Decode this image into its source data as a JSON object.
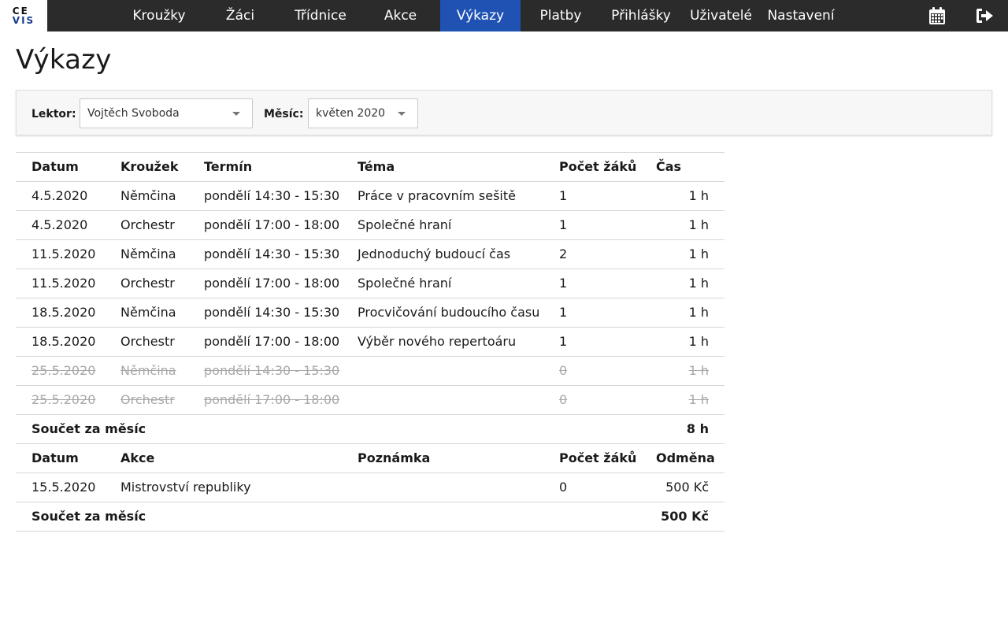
{
  "logo": {
    "line1": "CE",
    "line2": "VIS"
  },
  "nav": {
    "items": [
      {
        "label": "Kroužky",
        "active": false
      },
      {
        "label": "Žáci",
        "active": false
      },
      {
        "label": "Třídnice",
        "active": false
      },
      {
        "label": "Akce",
        "active": false
      },
      {
        "label": "Výkazy",
        "active": true
      },
      {
        "label": "Platby",
        "active": false
      },
      {
        "label": "Přihlášky",
        "active": false
      },
      {
        "label": "Uživatelé",
        "active": false
      },
      {
        "label": "Nastavení",
        "active": false
      }
    ],
    "icons": [
      "calendar-icon",
      "logout-icon"
    ]
  },
  "page": {
    "title": "Výkazy"
  },
  "filters": {
    "lecturer_label": "Lektor:",
    "lecturer_value": "Vojtěch Svoboda",
    "month_label": "Měsíc:",
    "month_value": "květen 2020"
  },
  "lessons": {
    "headers": {
      "date": "Datum",
      "club": "Kroužek",
      "term": "Termín",
      "topic": "Téma",
      "count": "Počet žáků",
      "time": "Čas"
    },
    "rows": [
      {
        "date": "4.5.2020",
        "club": "Němčina",
        "term": "pondělí 14:30 - 15:30",
        "topic": "Práce v pracovním sešitě",
        "count": "1",
        "time": "1 h",
        "cancelled": false
      },
      {
        "date": "4.5.2020",
        "club": "Orchestr",
        "term": "pondělí 17:00 - 18:00",
        "topic": "Společné hraní",
        "count": "1",
        "time": "1 h",
        "cancelled": false
      },
      {
        "date": "11.5.2020",
        "club": "Němčina",
        "term": "pondělí 14:30 - 15:30",
        "topic": "Jednoduchý budoucí čas",
        "count": "2",
        "time": "1 h",
        "cancelled": false
      },
      {
        "date": "11.5.2020",
        "club": "Orchestr",
        "term": "pondělí 17:00 - 18:00",
        "topic": "Společné hraní",
        "count": "1",
        "time": "1 h",
        "cancelled": false
      },
      {
        "date": "18.5.2020",
        "club": "Němčina",
        "term": "pondělí 14:30 - 15:30",
        "topic": "Procvičování budoucího času",
        "count": "1",
        "time": "1 h",
        "cancelled": false
      },
      {
        "date": "18.5.2020",
        "club": "Orchestr",
        "term": "pondělí 17:00 - 18:00",
        "topic": "Výběr nového repertoáru",
        "count": "1",
        "time": "1 h",
        "cancelled": false
      },
      {
        "date": "25.5.2020",
        "club": "Němčina",
        "term": "pondělí 14:30 - 15:30",
        "topic": "",
        "count": "0",
        "time": "1 h",
        "cancelled": true
      },
      {
        "date": "25.5.2020",
        "club": "Orchestr",
        "term": "pondělí 17:00 - 18:00",
        "topic": "",
        "count": "0",
        "time": "1 h",
        "cancelled": true
      }
    ],
    "sum_label": "Součet za měsíc",
    "sum_value": "8 h"
  },
  "events": {
    "headers": {
      "date": "Datum",
      "event": "Akce",
      "note": "Poznámka",
      "count": "Počet žáků",
      "reward": "Odměna"
    },
    "rows": [
      {
        "date": "15.5.2020",
        "event": "Mistrovství republiky",
        "note": "",
        "count": "0",
        "reward": "500 Kč"
      }
    ],
    "sum_label": "Součet za měsíc",
    "sum_value": "500 Kč"
  },
  "colors": {
    "topbar": "#2b2b2b",
    "active_nav": "#1f52b3",
    "border": "#d6d6d6",
    "cancelled_text": "#a8a8a8"
  }
}
